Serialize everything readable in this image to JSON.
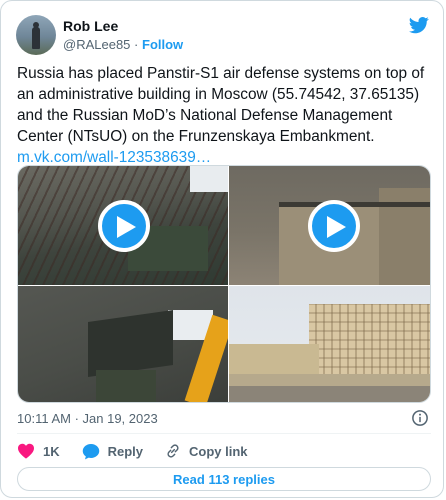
{
  "author": {
    "name": "Rob Lee",
    "handle": "@RALee85",
    "separator": "·",
    "follow_label": "Follow"
  },
  "tweet": {
    "text": "Russia has placed Panstir-S1 air defense systems on top of an administrative building in Moscow (55.74542, 37.65135) and the Russian MoD’s National Defense Management Center (NTsUO) on the Frunzenskaya Embankment.",
    "link": "m.vk.com/wall-123538639…",
    "timestamp": "10:11 AM · Jan 19, 2023"
  },
  "media": {
    "tiles": [
      {
        "kind": "video",
        "icon": "play-icon"
      },
      {
        "kind": "video",
        "icon": "play-icon"
      },
      {
        "kind": "photo"
      },
      {
        "kind": "photo"
      }
    ]
  },
  "actions": {
    "like_count": "1K",
    "reply_label": "Reply",
    "copy_link_label": "Copy link",
    "read_replies_label": "Read 113 replies"
  },
  "colors": {
    "accent": "#1d9bf0",
    "like": "#f91880",
    "secondary_text": "#536471",
    "border": "#cfd9de"
  }
}
